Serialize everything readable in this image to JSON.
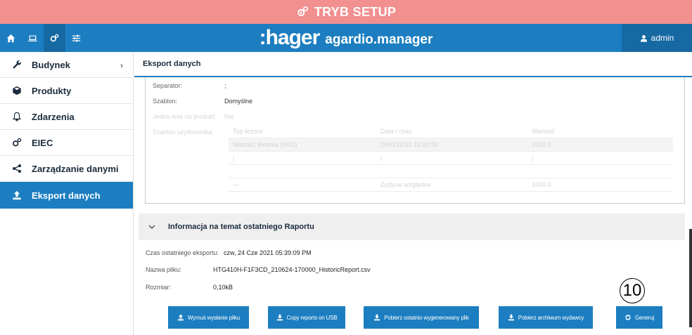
{
  "setup": {
    "title": "TRYB SETUP"
  },
  "brand": {
    "logo": ":hager",
    "app": "agardio.manager"
  },
  "user": {
    "name": "admin"
  },
  "sidebar": {
    "items": [
      {
        "label": "Budynek",
        "chevron": "›"
      },
      {
        "label": "Produkty"
      },
      {
        "label": "Zdarzenia"
      },
      {
        "label": "EIEC"
      },
      {
        "label": "Zarządzanie danymi"
      },
      {
        "label": "Eksport danych"
      }
    ]
  },
  "main": {
    "title": "Eksport danych",
    "config": {
      "separator_label": "Separator:",
      "separator_value": ";",
      "template_label": "Szablon:",
      "template_value": "Domyślne",
      "one_line_label": "Jedna linia na produkt:",
      "one_line_value": "Nie",
      "user_template_label": "Szablon użytkownika:",
      "user_table": {
        "headers": [
          "Typ liczoni",
          "Data i czas",
          "Wartość"
        ],
        "rows": [
          [
            "Wartość średnia (AVG)",
            "2000/12/31 12:00:00",
            "1000.0"
          ],
          [
            "|",
            "|",
            "|"
          ],
          [
            "",
            "",
            ""
          ],
          [
            "—",
            "Zużycie względne",
            "1000.0"
          ]
        ]
      }
    },
    "info": {
      "title": "Informacja na temat ostatniego Raportu",
      "last_export_label": "Czas ostatniego eksportu:",
      "last_export_value": "czw, 24 Cze 2021 05:39:09 PM",
      "file_label": "Nazwa pliku:",
      "file_value": "HTG410H-F1F3CD_210624-170000_HistoricReport.csv",
      "size_label": "Rozmiar:",
      "size_value": "0,10kB"
    },
    "buttons": {
      "force_send": "Wymuś wysłanie pliku",
      "copy_usb": "Copy reports on USB",
      "download_last": "Pobierz ostatnio wygenerowany plik",
      "download_archive": "Pobierz archiwum wydawcy",
      "generate": "Generuj"
    },
    "callout": "10"
  },
  "colors": {
    "setup_bar": "#f28f8f",
    "primary": "#1c7ec0",
    "primary_dark": "#1669a3"
  },
  "icons": {
    "setup": "gears-icon",
    "home": "home-icon",
    "monitor": "monitor-icon",
    "settings": "gears-icon",
    "sliders": "sliders-icon",
    "user": "user-icon",
    "sidebar": [
      "wrench-icon",
      "cube-icon",
      "bell-icon",
      "gears-icon",
      "share-icon",
      "upload-icon"
    ]
  }
}
